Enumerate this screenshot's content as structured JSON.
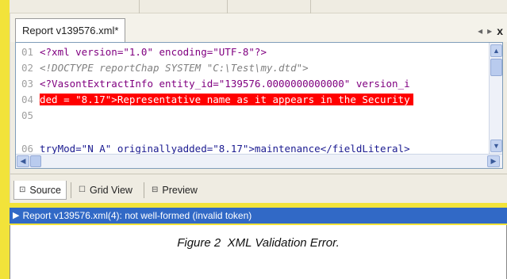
{
  "document_tab": {
    "label": "Report v139576.xml*"
  },
  "tab_controls": {
    "prev": "◂",
    "next": "▸",
    "close": "x"
  },
  "editor": {
    "lines": [
      {
        "num": "01",
        "text": "<?xml version=\"1.0\" encoding=\"UTF-8\"?>",
        "kind": "pi"
      },
      {
        "num": "02",
        "text": "<!DOCTYPE reportChap SYSTEM \"C:\\Test\\my.dtd\">",
        "kind": "cm"
      },
      {
        "num": "03",
        "text": "<?VasontExtractInfo entity_id=\"139576.0000000000000\" version_i",
        "kind": "pi"
      },
      {
        "num": "04",
        "text": "ded = \"8.17\">Representative name as it appears in the Security",
        "kind": "err"
      },
      {
        "num": "05",
        "text": "",
        "kind": "plain"
      },
      {
        "num": "06",
        "text": "tryMod=\"N A\" originallyadded=\"8.17\">maintenance</fieldLiteral>",
        "kind": "plain"
      }
    ]
  },
  "view_tabs": [
    {
      "icon": "⊡",
      "label": "Source",
      "active": true
    },
    {
      "icon": "☐",
      "label": "Grid View",
      "active": false
    },
    {
      "icon": "⊟",
      "label": "Preview",
      "active": false
    }
  ],
  "status": {
    "message": "Report v139576.xml(4): not well-formed (invalid token)"
  },
  "caption": {
    "text": "Figure 2  XML Validation Error."
  },
  "colors": {
    "frame": "#f2e33a",
    "status_bar": "#3169c6",
    "error_line": "#ff0000"
  }
}
